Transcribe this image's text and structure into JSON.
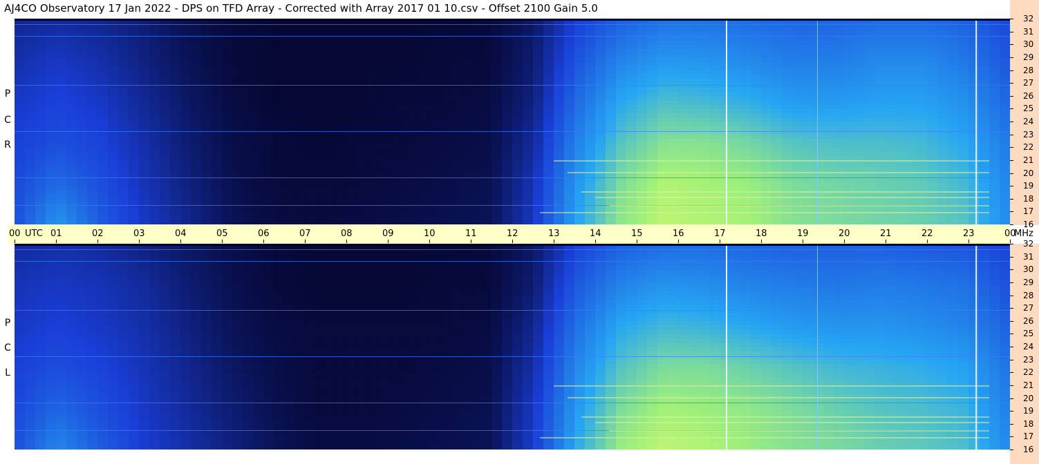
{
  "title": "AJ4CO Observatory  17 Jan 2022  -  DPS on TFD Array  -  Corrected with Array 2017 01 10.csv  -  Offset 2100  Gain 5.0",
  "panels": [
    {
      "id": "top",
      "polarization": [
        "R",
        "C",
        "P"
      ]
    },
    {
      "id": "bot",
      "polarization": [
        "L",
        "C",
        "P"
      ]
    }
  ],
  "time_axis": {
    "labels": [
      "00",
      "01",
      "02",
      "03",
      "04",
      "05",
      "06",
      "07",
      "08",
      "09",
      "10",
      "11",
      "12",
      "13",
      "14",
      "15",
      "16",
      "17",
      "18",
      "19",
      "20",
      "21",
      "22",
      "23",
      "00"
    ],
    "utc_label": "UTC"
  },
  "freq_axis": {
    "labels": [
      "16",
      "17",
      "18",
      "19",
      "20",
      "21",
      "22",
      "23",
      "24",
      "25",
      "26",
      "27",
      "28",
      "29",
      "30",
      "31",
      "32"
    ],
    "unit": "MHz"
  },
  "colors": {
    "background_dark": "#05052e",
    "low": "#1a3fd8",
    "mid": "#27a6f3",
    "high": "#9ef07a",
    "peak": "#ff4040",
    "right_scale": "#fddbc0",
    "time_bar": "#ffffc8"
  },
  "chart_data": {
    "type": "heatmap",
    "x_unit": "UTC hour",
    "y_unit": "MHz",
    "xlim": [
      0,
      24
    ],
    "ylim": [
      16,
      32
    ],
    "x_ticks": [
      0,
      1,
      2,
      3,
      4,
      5,
      6,
      7,
      8,
      9,
      10,
      11,
      12,
      13,
      14,
      15,
      16,
      17,
      18,
      19,
      20,
      21,
      22,
      23,
      24
    ],
    "y_ticks": [
      16,
      17,
      18,
      19,
      20,
      21,
      22,
      23,
      24,
      25,
      26,
      27,
      28,
      29,
      30,
      31,
      32
    ],
    "series": [
      {
        "name": "RCP",
        "values": [
          [
            0.3,
            0.55,
            0.35,
            0.22,
            0.14,
            0.06,
            0.03,
            0.02,
            0.03,
            0.04,
            0.05,
            0.06,
            0.22,
            0.6,
            0.82,
            0.9,
            0.88,
            0.86,
            0.8,
            0.78,
            0.76,
            0.74,
            0.7,
            0.5
          ],
          [
            0.28,
            0.4,
            0.3,
            0.2,
            0.12,
            0.05,
            0.02,
            0.02,
            0.02,
            0.03,
            0.04,
            0.05,
            0.2,
            0.55,
            0.78,
            0.88,
            0.86,
            0.84,
            0.78,
            0.76,
            0.74,
            0.72,
            0.66,
            0.48
          ],
          [
            0.25,
            0.3,
            0.26,
            0.18,
            0.1,
            0.04,
            0.02,
            0.01,
            0.02,
            0.02,
            0.03,
            0.04,
            0.16,
            0.48,
            0.7,
            0.8,
            0.8,
            0.76,
            0.7,
            0.68,
            0.68,
            0.66,
            0.6,
            0.44
          ],
          [
            0.22,
            0.26,
            0.22,
            0.15,
            0.08,
            0.03,
            0.01,
            0.01,
            0.01,
            0.02,
            0.02,
            0.03,
            0.12,
            0.4,
            0.6,
            0.68,
            0.66,
            0.62,
            0.56,
            0.56,
            0.58,
            0.58,
            0.52,
            0.38
          ],
          [
            0.18,
            0.22,
            0.18,
            0.12,
            0.06,
            0.02,
            0.01,
            0.01,
            0.01,
            0.01,
            0.02,
            0.02,
            0.1,
            0.32,
            0.48,
            0.55,
            0.54,
            0.5,
            0.46,
            0.46,
            0.5,
            0.5,
            0.44,
            0.32
          ],
          [
            0.14,
            0.16,
            0.14,
            0.1,
            0.05,
            0.02,
            0.01,
            0.01,
            0.01,
            0.01,
            0.01,
            0.02,
            0.08,
            0.25,
            0.36,
            0.42,
            0.42,
            0.4,
            0.38,
            0.38,
            0.4,
            0.4,
            0.36,
            0.28
          ]
        ]
      },
      {
        "name": "LCP",
        "values": [
          [
            0.3,
            0.5,
            0.35,
            0.24,
            0.18,
            0.12,
            0.06,
            0.03,
            0.03,
            0.04,
            0.05,
            0.06,
            0.24,
            0.62,
            0.84,
            0.9,
            0.88,
            0.84,
            0.8,
            0.78,
            0.74,
            0.72,
            0.68,
            0.5
          ],
          [
            0.28,
            0.38,
            0.3,
            0.22,
            0.16,
            0.1,
            0.05,
            0.02,
            0.02,
            0.03,
            0.04,
            0.05,
            0.22,
            0.56,
            0.78,
            0.86,
            0.84,
            0.82,
            0.78,
            0.74,
            0.7,
            0.68,
            0.64,
            0.46
          ],
          [
            0.25,
            0.3,
            0.26,
            0.2,
            0.14,
            0.08,
            0.04,
            0.02,
            0.02,
            0.02,
            0.03,
            0.04,
            0.18,
            0.5,
            0.7,
            0.78,
            0.78,
            0.74,
            0.7,
            0.66,
            0.64,
            0.62,
            0.58,
            0.42
          ],
          [
            0.22,
            0.25,
            0.22,
            0.18,
            0.12,
            0.06,
            0.03,
            0.02,
            0.02,
            0.02,
            0.02,
            0.03,
            0.14,
            0.42,
            0.6,
            0.66,
            0.64,
            0.6,
            0.56,
            0.54,
            0.54,
            0.52,
            0.48,
            0.36
          ],
          [
            0.2,
            0.22,
            0.2,
            0.16,
            0.1,
            0.05,
            0.02,
            0.01,
            0.01,
            0.01,
            0.02,
            0.02,
            0.1,
            0.34,
            0.48,
            0.54,
            0.52,
            0.48,
            0.46,
            0.44,
            0.46,
            0.44,
            0.42,
            0.3
          ],
          [
            0.16,
            0.18,
            0.16,
            0.12,
            0.08,
            0.04,
            0.02,
            0.01,
            0.01,
            0.01,
            0.01,
            0.02,
            0.08,
            0.26,
            0.36,
            0.4,
            0.4,
            0.38,
            0.36,
            0.36,
            0.36,
            0.34,
            0.32,
            0.26
          ]
        ]
      }
    ],
    "value_note_levels": [
      "low",
      "mid",
      "high",
      "peak"
    ]
  }
}
